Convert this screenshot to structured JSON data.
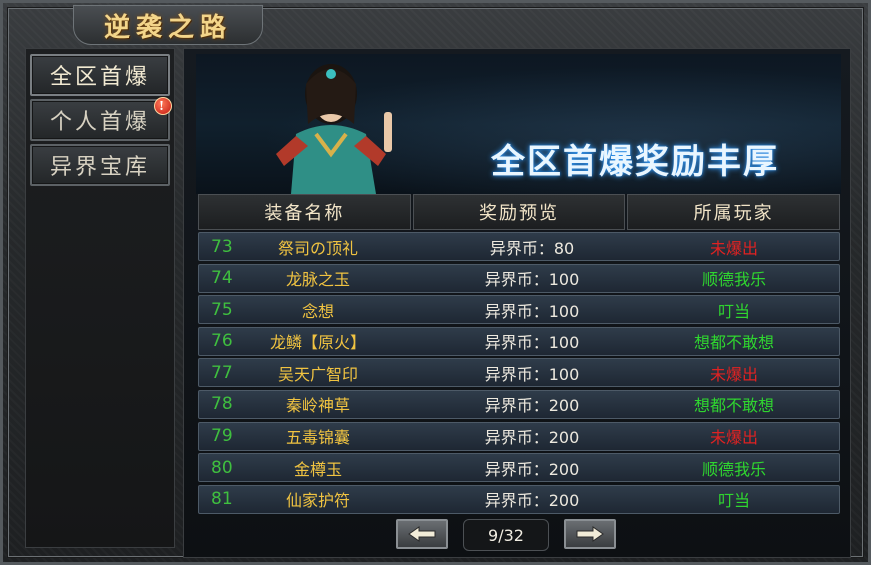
{
  "window": {
    "title": "逆袭之路"
  },
  "sidebar": {
    "items": [
      {
        "label": "全区首爆",
        "active": true
      },
      {
        "label": "个人首爆",
        "badge": "!"
      },
      {
        "label": "异界宝库"
      }
    ]
  },
  "banner": {
    "slogan": "全区首爆奖励丰厚"
  },
  "table": {
    "headers": [
      "装备名称",
      "奖励预览",
      "所属玩家"
    ],
    "rows": [
      {
        "no": "73",
        "name": "祭司の顶礼",
        "reward": "异界币：80",
        "player": "未爆出",
        "status": "red"
      },
      {
        "no": "74",
        "name": "龙脉之玉",
        "reward": "异界币：100",
        "player": "顺德我乐",
        "status": "green"
      },
      {
        "no": "75",
        "name": "念想",
        "reward": "异界币：100",
        "player": "叮当",
        "status": "green"
      },
      {
        "no": "76",
        "name": "龙鳞【原火】",
        "reward": "异界币：100",
        "player": "想都不敢想",
        "status": "green"
      },
      {
        "no": "77",
        "name": "吴天广智印",
        "reward": "异界币：100",
        "player": "未爆出",
        "status": "red"
      },
      {
        "no": "78",
        "name": "秦岭神草",
        "reward": "异界币：200",
        "player": "想都不敢想",
        "status": "green"
      },
      {
        "no": "79",
        "name": "五毒锦囊",
        "reward": "异界币：200",
        "player": "未爆出",
        "status": "red"
      },
      {
        "no": "80",
        "name": "金樽玉",
        "reward": "异界币：200",
        "player": "顺德我乐",
        "status": "green"
      },
      {
        "no": "81",
        "name": "仙家护符",
        "reward": "异界币：200",
        "player": "叮当",
        "status": "green"
      }
    ]
  },
  "pager": {
    "indicator": "9/32",
    "prev_icon": "arrow-left-icon",
    "next_icon": "arrow-right-icon"
  },
  "colors": {
    "accent_gold": "#f0c341",
    "status_red": "#e02222",
    "status_green": "#2fd62f",
    "index_green": "#3fbf3f"
  }
}
